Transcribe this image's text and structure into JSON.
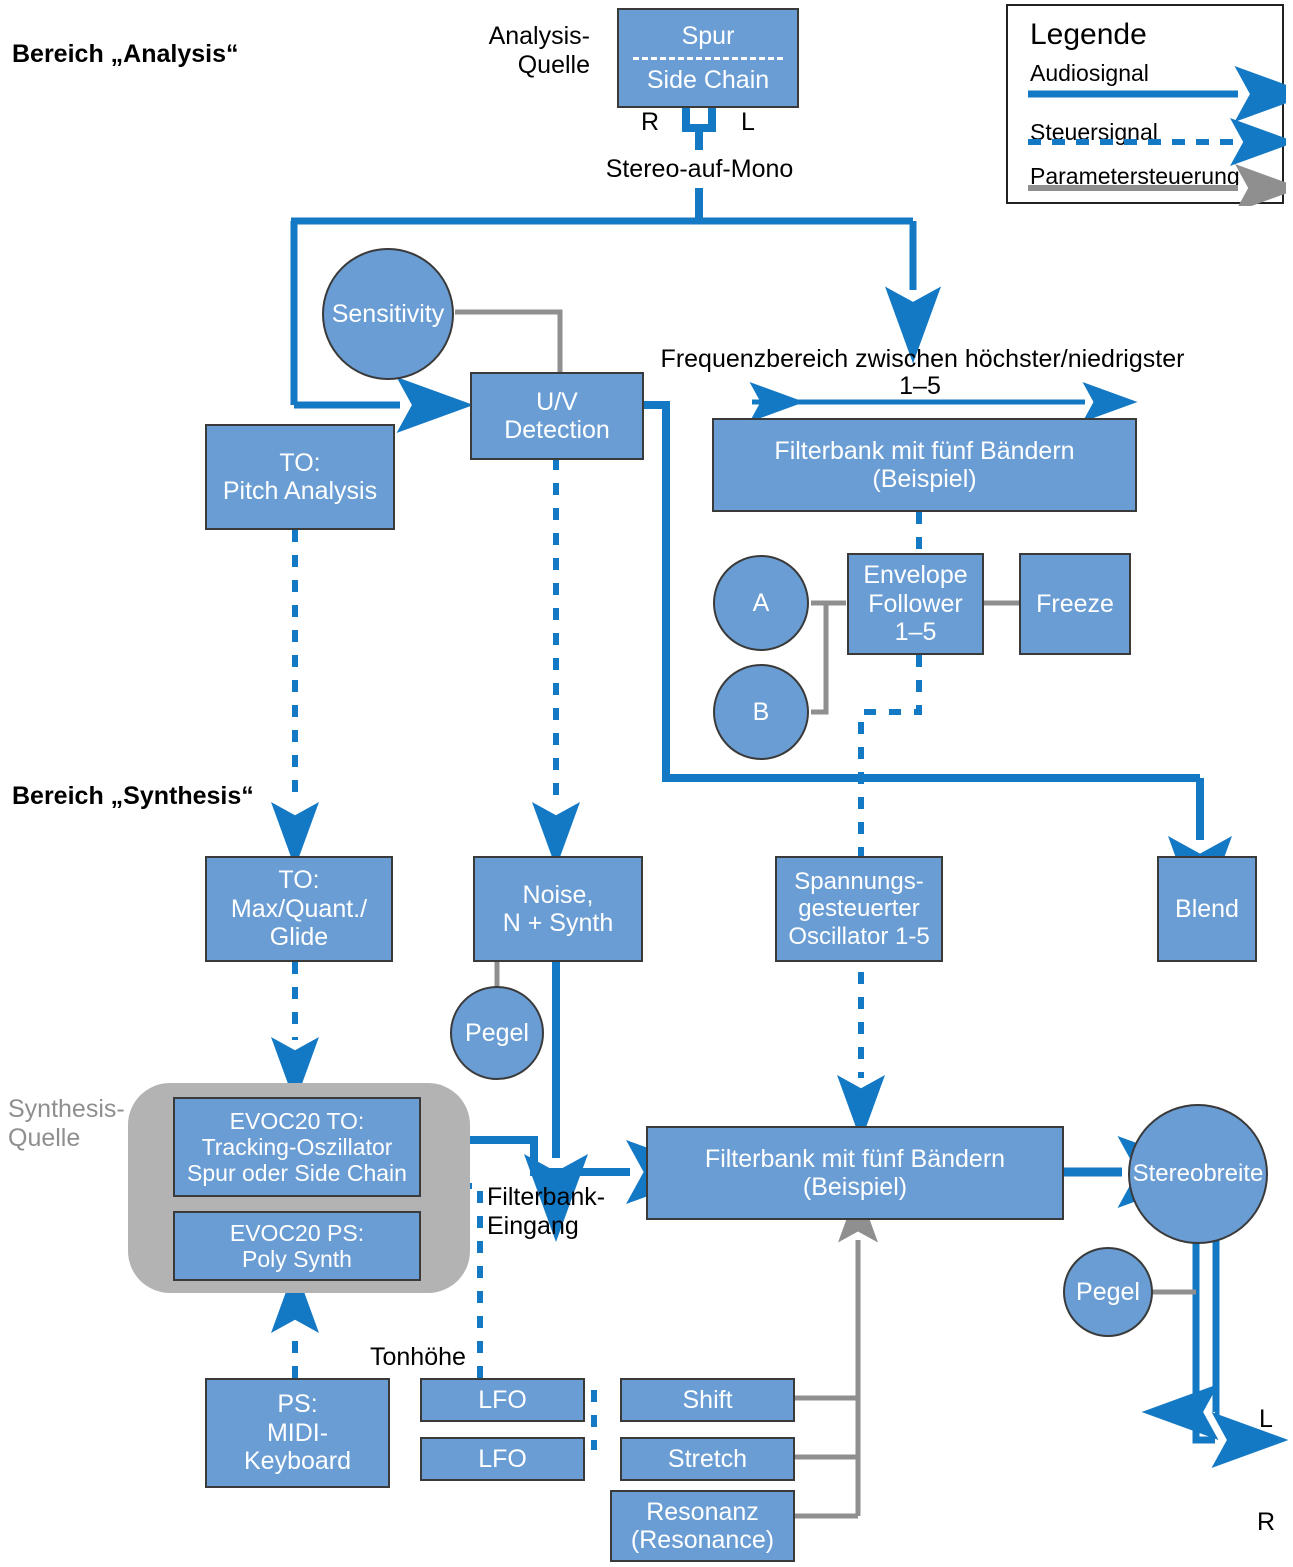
{
  "titles": {
    "analysis_section": "Bereich „Analysis“",
    "synthesis_section": "Bereich „Synthesis“"
  },
  "labels": {
    "analysis_source": "Analysis-\nQuelle",
    "synthesis_source": "Synthesis-\nQuelle",
    "channel_r": "R",
    "channel_l": "L",
    "stereo_to_mono": "Stereo-auf-Mono",
    "freq_range": "Frequenzbereich zwischen höchster/niedrigster",
    "freq_range_count": "1–5",
    "filterbank_input": "Filterbank-\nEingang",
    "pitch": "Tonhöhe",
    "out_l": "L",
    "out_r": "R"
  },
  "nodes": {
    "source_track": "Spur",
    "source_sidechain": "Side Chain",
    "sensitivity": "Sensitivity",
    "uv_detection": "U/V\nDetection",
    "to_pitch_analysis": "TO:\nPitch Analysis",
    "filterbank_analysis": "Filterbank mit fünf Bändern\n(Beispiel)",
    "knob_a": "A",
    "knob_b": "B",
    "envelope_follower": "Envelope\nFollower\n1–5",
    "freeze": "Freeze",
    "to_max_quant_glide": "TO:\nMax/Quant./\nGlide",
    "noise_synth": "Noise,\nN + Synth",
    "pegel_noise": "Pegel",
    "vco": "Spannungs-\ngesteuerter\nOscillator 1-5",
    "blend": "Blend",
    "evoc20_to": "EVOC20 TO:\nTracking-Oszillator\nSpur oder Side Chain",
    "evoc20_ps": "EVOC20 PS:\nPoly Synth",
    "filterbank_synthesis": "Filterbank mit fünf Bändern\n(Beispiel)",
    "stereobreite": "Stereobreite",
    "pegel_stereo": "Pegel",
    "ps_midi_keyboard": "PS:\nMIDI-\nKeyboard",
    "lfo_1": "LFO",
    "lfo_2": "LFO",
    "shift": "Shift",
    "stretch": "Stretch",
    "resonanz": "Resonanz\n(Resonance)"
  },
  "legend": {
    "title": "Legende",
    "rows": [
      {
        "label": "Audiosignal",
        "style": "solid",
        "color": "#1479c4"
      },
      {
        "label": "Steuersignal",
        "style": "dashed",
        "color": "#1479c4"
      },
      {
        "label": "Parametersteuerung",
        "style": "solid",
        "color": "#8f8f8f"
      }
    ]
  },
  "colors": {
    "node_fill": "#6a9dd4",
    "node_border": "#3a3a3a",
    "audio_signal": "#1479c4",
    "control_signal": "#1479c4",
    "parameter_control": "#8f8f8f",
    "source_group": "#b3b3b3",
    "text_on_node": "#ffffff"
  }
}
